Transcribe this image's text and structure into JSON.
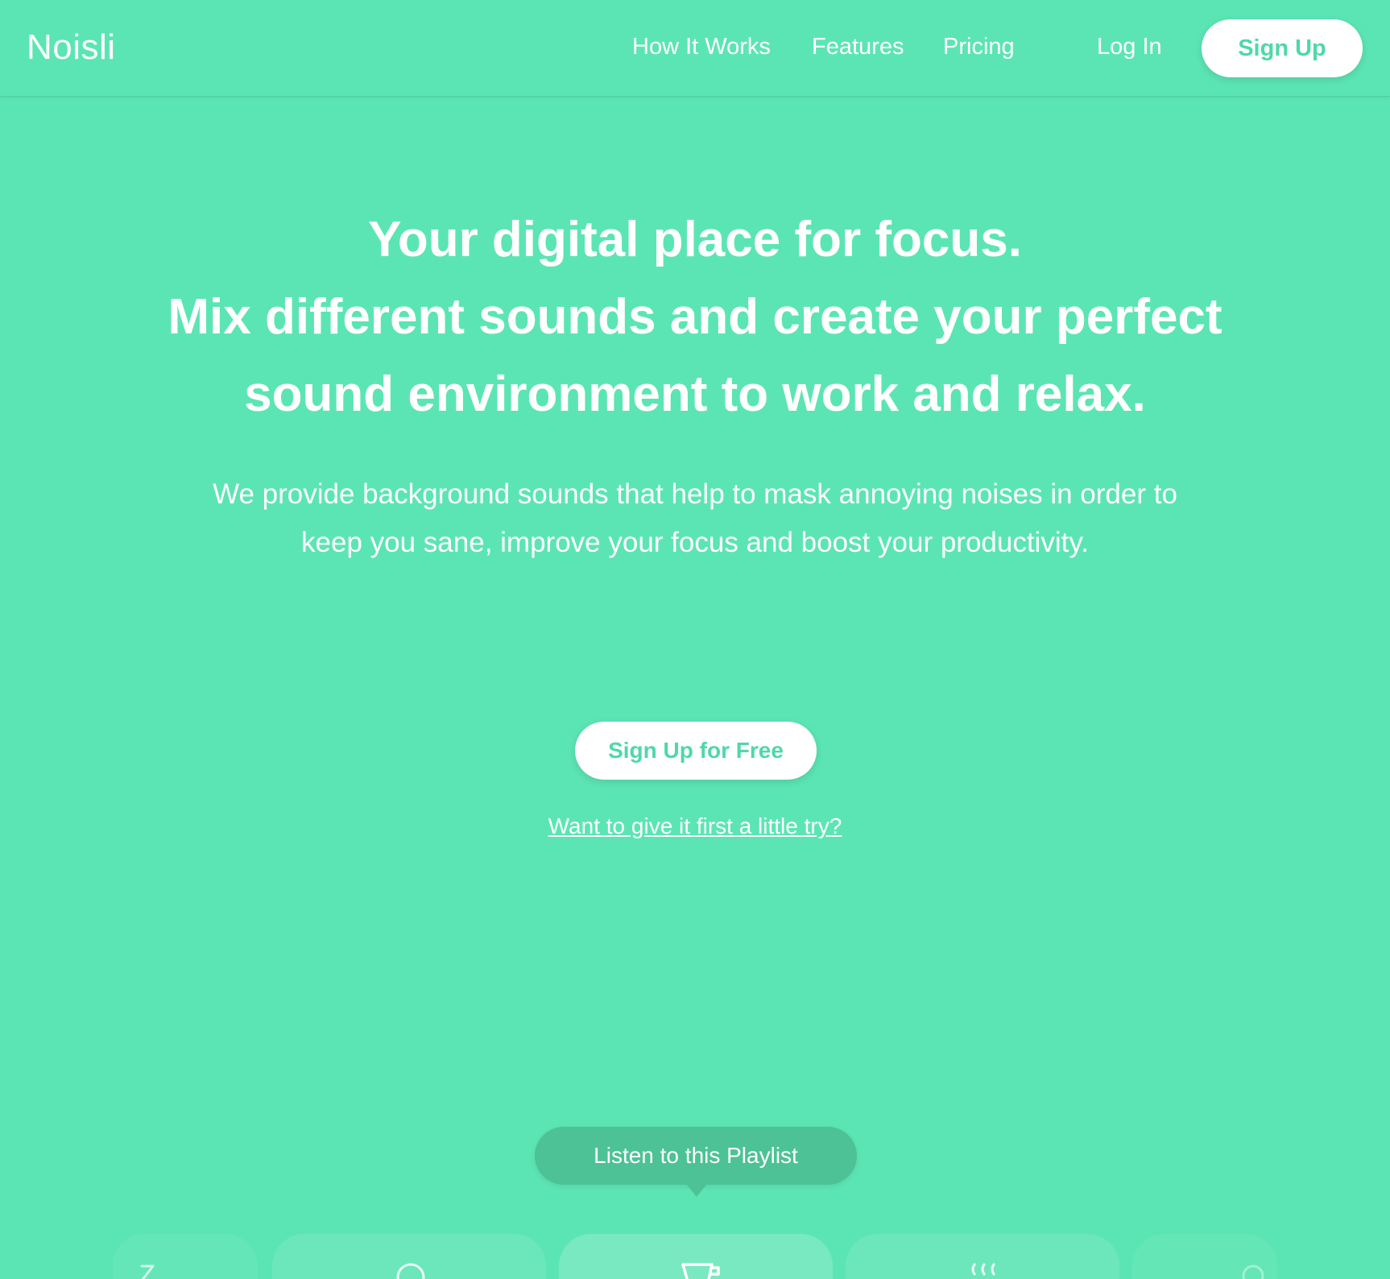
{
  "brand": {
    "logo_text": "Noisli",
    "background_color": "#5ce5b4",
    "accent_color": "#4fd8a8"
  },
  "nav": {
    "links": [
      "How It Works",
      "Features",
      "Pricing"
    ],
    "login_label": "Log In",
    "signup_label": "Sign Up"
  },
  "hero": {
    "title_lines": [
      "Your digital place for focus.",
      "Mix different sounds and create your perfect",
      "sound environment to work and relax."
    ],
    "description": "We provide background sounds that help to mask annoying noises in order to keep you sane, improve your focus and boost your productivity.",
    "cta_label": "Sign Up for Free",
    "try_link_label": "Want to give it first a little try?"
  },
  "playlist": {
    "tooltip_label": "Listen to this Playlist",
    "cards": [
      {
        "icon": "sleep-icon"
      },
      {
        "icon": "sun-icon"
      },
      {
        "icon": "coffee-cup-icon"
      },
      {
        "icon": "steam-icon"
      },
      {
        "icon": "partial-icon"
      }
    ]
  }
}
